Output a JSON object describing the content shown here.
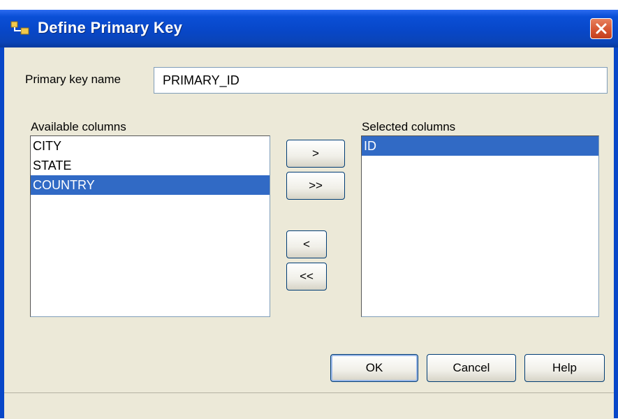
{
  "window": {
    "title": "Define Primary Key"
  },
  "form": {
    "pk_label": "Primary key name",
    "pk_value": "PRIMARY_ID",
    "available_label": "Available columns",
    "selected_label": "Selected columns"
  },
  "available_columns": [
    {
      "label": "CITY",
      "selected": false
    },
    {
      "label": "STATE",
      "selected": false
    },
    {
      "label": "COUNTRY",
      "selected": true
    }
  ],
  "selected_columns": [
    {
      "label": "ID",
      "selected": true
    }
  ],
  "transfer": {
    "add_one": ">",
    "add_all": ">>",
    "remove_one": "<",
    "remove_all": "<<"
  },
  "footer": {
    "ok": "OK",
    "cancel": "Cancel",
    "help": "Help"
  },
  "colors": {
    "titlebar": "#0847c8",
    "selection": "#316ac5",
    "dialog_bg": "#ece9d8",
    "close": "#d4522f"
  }
}
